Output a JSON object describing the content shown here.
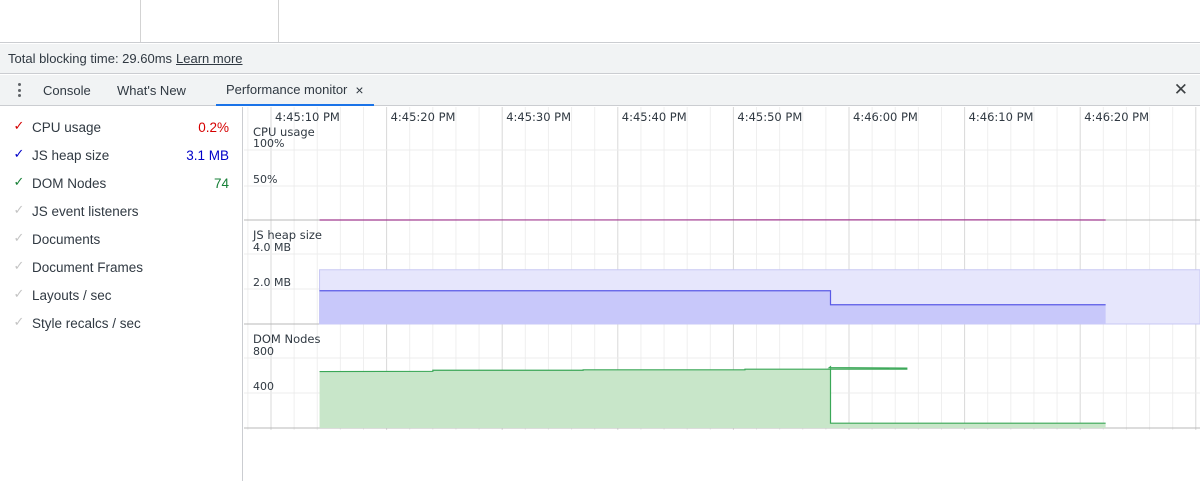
{
  "status_bar": {
    "tbt_text": "Total blocking time: 29.60ms",
    "learn_more": "Learn more"
  },
  "drawer": {
    "tabs": [
      {
        "label": "Console"
      },
      {
        "label": "What's New"
      },
      {
        "label": "Performance monitor"
      }
    ],
    "active_tab_close": "×",
    "close_drawer": "✕"
  },
  "metrics": [
    {
      "label": "CPU usage",
      "value": "0.2%",
      "checked": true,
      "color": "#d50000"
    },
    {
      "label": "JS heap size",
      "value": "3.1 MB",
      "checked": true,
      "color": "#0000c8"
    },
    {
      "label": "DOM Nodes",
      "value": "74",
      "checked": true,
      "color": "#188038"
    },
    {
      "label": "JS event listeners",
      "value": "",
      "checked": false
    },
    {
      "label": "Documents",
      "value": "",
      "checked": false
    },
    {
      "label": "Document Frames",
      "value": "",
      "checked": false
    },
    {
      "label": "Layouts / sec",
      "value": "",
      "checked": false
    },
    {
      "label": "Style recalcs / sec",
      "value": "",
      "checked": false
    }
  ],
  "chart_data": {
    "type": "area",
    "time_labels": [
      "4:45:10 PM",
      "4:45:20 PM",
      "4:45:30 PM",
      "4:45:40 PM",
      "4:45:50 PM",
      "4:46:00 PM",
      "4:46:10 PM",
      "4:46:20 PM"
    ],
    "panels": [
      {
        "name": "CPU usage",
        "ticks": [
          "100%",
          "50%"
        ],
        "color": "#a03a8f",
        "points": [
          [
            4.2,
            0
          ],
          [
            52,
            0.2
          ],
          [
            60,
            0.2
          ],
          [
            72.2,
            0
          ]
        ],
        "unit_max": 100
      },
      {
        "name": "JS heap size",
        "ticks": [
          "4.0 MB",
          "2.0 MB"
        ],
        "color": "#5a5ae6",
        "upper": 3.1,
        "points": [
          [
            4.2,
            1.9
          ],
          [
            48.4,
            1.9
          ],
          [
            48.4,
            1.1
          ],
          [
            72.2,
            1.1
          ]
        ]
      },
      {
        "name": "DOM Nodes",
        "ticks": [
          "800",
          "400"
        ],
        "color": "#3aa757",
        "points": [
          [
            4.2,
            645
          ],
          [
            14,
            648
          ],
          [
            14,
            660
          ],
          [
            27,
            660
          ],
          [
            27,
            665
          ],
          [
            41,
            665
          ],
          [
            41,
            672
          ],
          [
            55,
            672
          ],
          [
            55,
            685
          ],
          [
            48.3,
            690
          ],
          [
            48.4,
            700
          ],
          [
            48.4,
            55
          ],
          [
            72.2,
            55
          ]
        ]
      }
    ]
  }
}
